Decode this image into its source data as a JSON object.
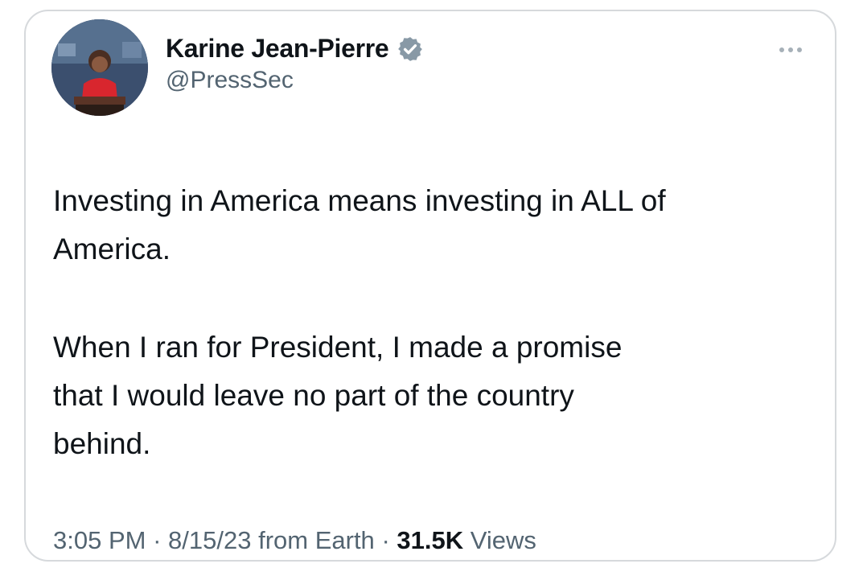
{
  "tweet": {
    "author": {
      "display_name": "Karine Jean-Pierre",
      "handle": "@PressSec",
      "verified": true,
      "verified_color": "#8899a6"
    },
    "body": {
      "paragraph_1": "Investing in America means investing in ALL of\nAmerica.",
      "paragraph_2": "When I ran for President, I made a promise\nthat I would leave no part of the country\nbehind."
    },
    "meta": {
      "time": "3:05 PM",
      "separator": "·",
      "date": "8/15/23",
      "source": "from Earth",
      "views_count": "31.5K",
      "views_label": "Views"
    },
    "icons": {
      "more": "more-options-icon",
      "verified": "verified-badge-icon"
    }
  },
  "colors": {
    "border": "#d6d9dc",
    "text": "#0f1419",
    "secondary_text": "#536471"
  }
}
